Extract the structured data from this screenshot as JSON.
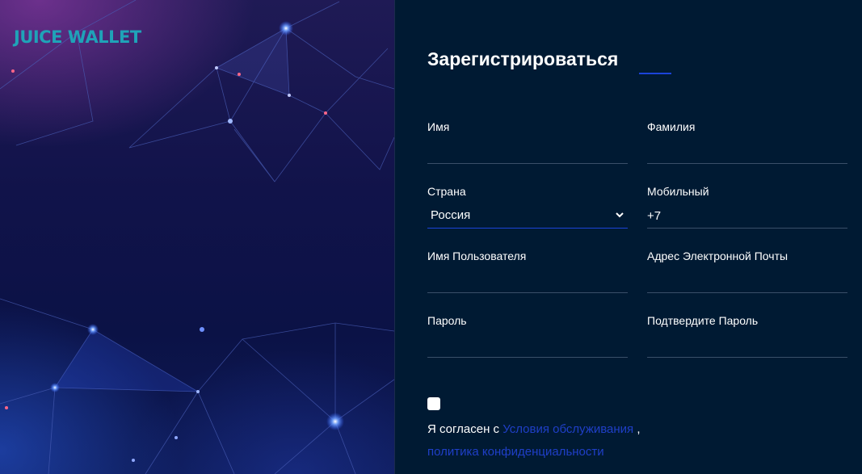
{
  "brand": {
    "logo_text": "JUICE WALLET"
  },
  "form": {
    "title": "Зарегистрироваться",
    "first_name": {
      "label": "Имя",
      "value": ""
    },
    "last_name": {
      "label": "Фамилия",
      "value": ""
    },
    "country": {
      "label": "Страна",
      "selected": "Россия"
    },
    "mobile": {
      "label": "Мобильный",
      "value": "+7"
    },
    "username": {
      "label": "Имя Пользователя",
      "value": ""
    },
    "email": {
      "label": "Адрес Электронной Почты",
      "value": ""
    },
    "password": {
      "label": "Пароль",
      "value": ""
    },
    "confirm_password": {
      "label": "Подтвердите Пароль",
      "value": ""
    },
    "agreement": {
      "checked": false,
      "prefix": "Я согласен с",
      "terms_link": "Условия обслуживания",
      "separator": ",",
      "privacy_link": "политика конфиденциальности"
    }
  },
  "colors": {
    "background": "#001a33",
    "accent": "#1b44d8",
    "link": "#1f3fc7",
    "logo": "#1fa3b8"
  }
}
